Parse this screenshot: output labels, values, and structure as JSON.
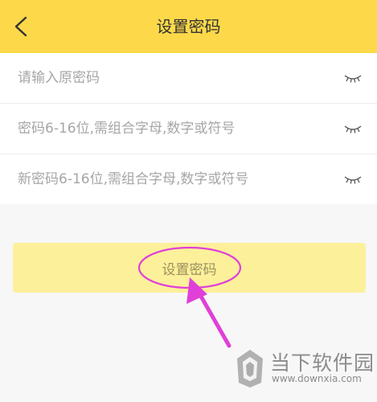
{
  "header": {
    "title": "设置密码",
    "back_icon": "chevron-left-icon",
    "background_color": "#fdd94a"
  },
  "form": {
    "fields": [
      {
        "placeholder": "请输入原密码",
        "value": "",
        "toggle_icon": "eye-closed-icon"
      },
      {
        "placeholder": "密码6-16位,需组合字母,数字或符号",
        "value": "",
        "toggle_icon": "eye-closed-icon"
      },
      {
        "placeholder": "新密码6-16位,需组合字母,数字或符号",
        "value": "",
        "toggle_icon": "eye-closed-icon"
      }
    ]
  },
  "submit": {
    "label": "设置密码",
    "background_color": "#fdf09a"
  },
  "annotation": {
    "color": "#e040d8",
    "shapes": [
      "ellipse",
      "arrow"
    ]
  },
  "watermark": {
    "title": "当下软件园",
    "url": "www.downxia.com",
    "logo_icon": "downxia-logo-icon"
  }
}
